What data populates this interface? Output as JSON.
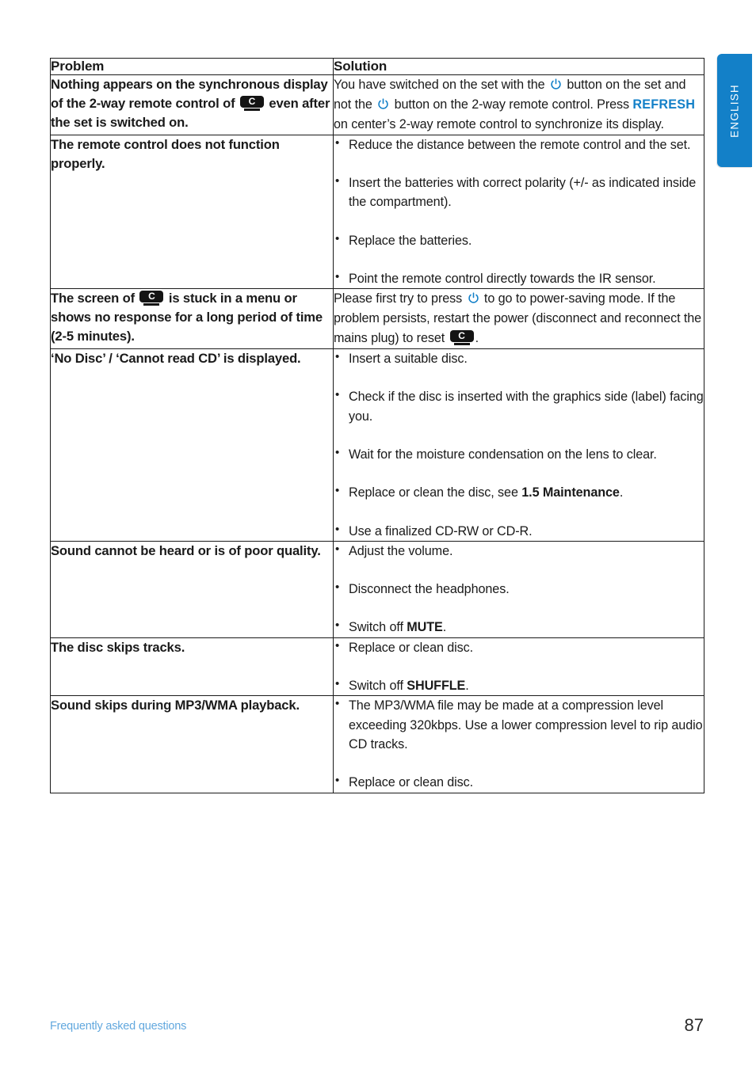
{
  "page": {
    "number": "87",
    "footer_section": "Frequently asked questions",
    "language_tab": "ENGLISH",
    "accent_color": "#1380c8",
    "footer_link_color": "#62a8de"
  },
  "table": {
    "headers": {
      "problem": "Problem",
      "solution": "Solution"
    },
    "rows": [
      {
        "problem_parts": [
          {
            "text": "Nothing appears on the synchronous display of the 2-way remote control of "
          },
          {
            "icon": "center-device-icon"
          },
          {
            "text": " even after the set is switched on."
          }
        ],
        "problem_text": "Nothing appears on the synchronous display of the 2-way remote control of [device] even after the set is switched on.",
        "solution_type": "paragraph",
        "solution_parts": [
          {
            "text": "You have switched on the set with the "
          },
          {
            "icon": "power-icon"
          },
          {
            "text": " button on the set and not the "
          },
          {
            "icon": "power-icon"
          },
          {
            "text": " button on the 2-way remote control. Press "
          },
          {
            "accent": "REFRESH"
          },
          {
            "text": " on center’s 2-way remote control to synchronize its display."
          }
        ],
        "solution_text": "You have switched on the set with the [power] button on the set and not the [power] button on the 2-way remote control. Press REFRESH on center's 2-way remote control to synchronize its display."
      },
      {
        "problem_parts": [
          {
            "text": "The remote control does not function properly."
          }
        ],
        "problem_text": "The remote control does not function properly.",
        "solution_type": "bullets",
        "bullets": [
          [
            {
              "text": "Reduce the distance between the remote control and the set."
            }
          ],
          [
            {
              "text": "Insert the batteries with correct polarity (+/- as indicated inside the compartment)."
            }
          ],
          [
            {
              "text": "Replace the batteries."
            }
          ],
          [
            {
              "text": "Point the remote control directly towards the IR sensor."
            }
          ]
        ]
      },
      {
        "problem_parts": [
          {
            "text": "The screen of "
          },
          {
            "icon": "center-device-icon"
          },
          {
            "text": " is stuck in a menu or shows no response for a long period of time (2-5 minutes)."
          }
        ],
        "problem_text": "The screen of [device] is stuck in a menu or shows no response for a long period of time (2-5 minutes).",
        "solution_type": "paragraph",
        "solution_parts": [
          {
            "text": "Please first try to press "
          },
          {
            "icon": "power-icon"
          },
          {
            "text": " to go to power-saving mode. If the problem persists, restart the power (disconnect and reconnect the mains plug) to reset "
          },
          {
            "icon": "center-device-icon"
          },
          {
            "text": "."
          }
        ],
        "solution_text": "Please first try to press [power] to go to power-saving mode. If the problem persists, restart the power (disconnect and reconnect the mains plug) to reset [device]."
      },
      {
        "problem_parts": [
          {
            "text": "‘No Disc’ / ‘Cannot read CD’ is displayed."
          }
        ],
        "problem_text": "'No Disc' / 'Cannot read CD' is displayed.",
        "solution_type": "bullets",
        "bullets": [
          [
            {
              "text": "Insert a suitable disc."
            }
          ],
          [
            {
              "text": "Check if the disc is inserted with the graphics side (label) facing you."
            }
          ],
          [
            {
              "text": "Wait for the moisture condensation on the lens to clear."
            }
          ],
          [
            {
              "text": "Replace or clean the disc, see "
            },
            {
              "strong": "1.5 Maintenance"
            },
            {
              "text": "."
            }
          ],
          [
            {
              "text": "Use a finalized CD-RW or CD-R."
            }
          ]
        ]
      },
      {
        "problem_parts": [
          {
            "text": "Sound cannot be heard or is of poor quality."
          }
        ],
        "problem_text": "Sound cannot be heard or is of poor quality.",
        "solution_type": "bullets",
        "bullets": [
          [
            {
              "text": "Adjust the volume."
            }
          ],
          [
            {
              "text": "Disconnect the headphones."
            }
          ],
          [
            {
              "text": "Switch off "
            },
            {
              "strong": "MUTE"
            },
            {
              "text": "."
            }
          ]
        ]
      },
      {
        "problem_parts": [
          {
            "text": "The disc skips tracks."
          }
        ],
        "problem_text": "The disc skips tracks.",
        "solution_type": "bullets",
        "bullets": [
          [
            {
              "text": "Replace or clean disc."
            }
          ],
          [
            {
              "text": "Switch off "
            },
            {
              "strong": "SHUFFLE"
            },
            {
              "text": "."
            }
          ]
        ]
      },
      {
        "problem_parts": [
          {
            "text": "Sound skips during MP3/WMA playback."
          }
        ],
        "problem_text": "Sound skips during MP3/WMA playback.",
        "solution_type": "bullets",
        "bullets": [
          [
            {
              "text": "The MP3/WMA file may be made at a compression level exceeding 320kbps. Use a lower compression level to rip audio CD tracks."
            }
          ],
          [
            {
              "text": "Replace or clean disc."
            }
          ]
        ]
      }
    ]
  }
}
